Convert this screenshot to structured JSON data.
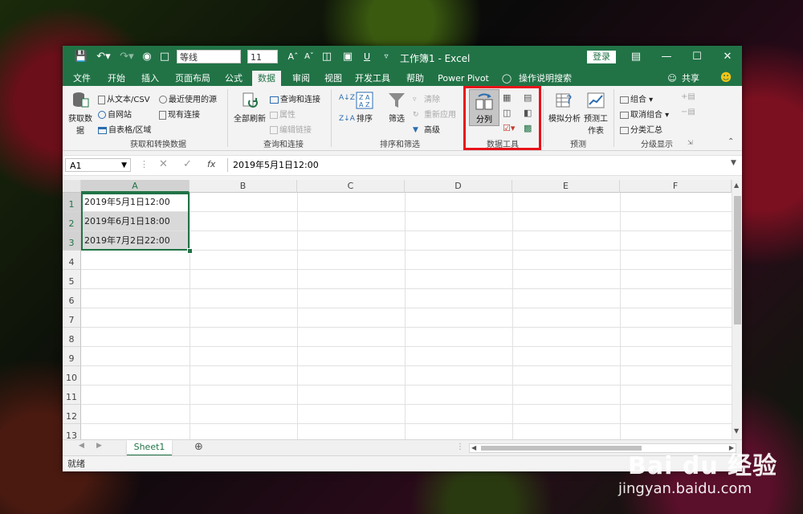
{
  "titlebar": {
    "font_name": "等线",
    "font_size": "11",
    "doc_title": "工作簿1  -  Excel",
    "login_label": "登录"
  },
  "tabs": [
    "文件",
    "开始",
    "插入",
    "页面布局",
    "公式",
    "数据",
    "审阅",
    "视图",
    "开发工具",
    "帮助",
    "Power Pivot",
    "操作说明搜索",
    "共享"
  ],
  "active_tab": "数据",
  "ribbon": {
    "get_data": {
      "big_label": "获取数据",
      "from_text": "从文本/CSV",
      "from_web": "自网站",
      "from_table": "自表格/区域",
      "recent_sources": "最近使用的源",
      "existing_connections": "现有连接",
      "group_label": "获取和转换数据"
    },
    "queries": {
      "refresh_all": "全部刷新",
      "queries_connections": "查询和连接",
      "properties": "属性",
      "edit_links": "编辑链接",
      "group_label": "查询和连接"
    },
    "sort_filter": {
      "sort": "排序",
      "filter": "筛选",
      "clear": "清除",
      "reapply": "重新应用",
      "advanced": "高级",
      "group_label": "排序和筛选"
    },
    "data_tools": {
      "text_to_columns": "分列",
      "group_label": "数据工具"
    },
    "forecast": {
      "what_if": "模拟分析",
      "forecast_sheet": "预测工作表",
      "group_label": "预测"
    },
    "outline": {
      "group": "组合",
      "ungroup": "取消组合",
      "subtotal": "分类汇总",
      "group_label": "分级显示"
    }
  },
  "formula_bar": {
    "name_box": "A1",
    "fx": "fx",
    "content": "2019年5月1日12:00"
  },
  "columns": [
    "A",
    "B",
    "C",
    "D",
    "E",
    "F"
  ],
  "rows": [
    "1",
    "2",
    "3",
    "4",
    "5",
    "6",
    "7",
    "8",
    "9",
    "10",
    "11",
    "12",
    "13"
  ],
  "cells": {
    "A1": "2019年5月1日12:00",
    "A2": "2019年6月1日18:00",
    "A3": "2019年7月2日22:00"
  },
  "sheets": [
    "Sheet1"
  ],
  "status": "就绪",
  "watermark": {
    "logo": "Bai du 经验",
    "url": "jingyan.baidu.com"
  },
  "colors": {
    "excel_green": "#217346",
    "highlight_red": "#e8121a"
  }
}
